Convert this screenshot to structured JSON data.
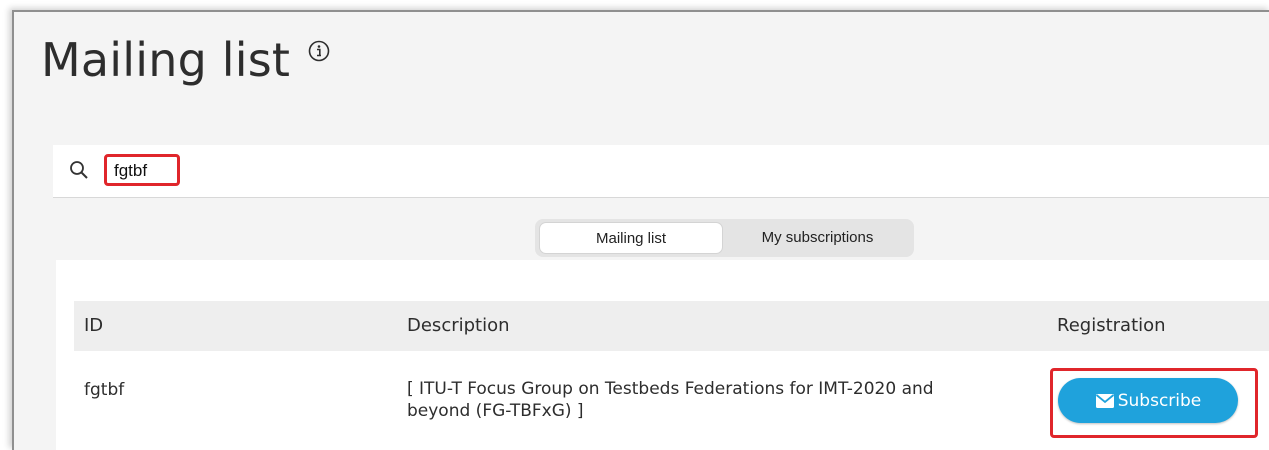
{
  "page": {
    "title": "Mailing list",
    "info_icon": "info-circle-icon"
  },
  "search": {
    "icon": "search-icon",
    "value": "fgtbf",
    "placeholder": ""
  },
  "tabs": [
    {
      "label": "Mailing list",
      "active": true
    },
    {
      "label": "My subscriptions",
      "active": false
    }
  ],
  "table": {
    "headers": [
      "ID",
      "Description",
      "Registration"
    ],
    "rows": [
      {
        "id": "fgtbf",
        "description_line1": "[ ITU-T Focus Group on Testbeds Federations for IMT-2020 and",
        "description_line2": "beyond (FG-TBFxG) ]",
        "action_label": "Subscribe",
        "action_icon": "envelope-icon"
      }
    ]
  },
  "colors": {
    "accent": "#1fa2dc",
    "highlight": "#e0262b",
    "background": "#f4f4f4"
  }
}
